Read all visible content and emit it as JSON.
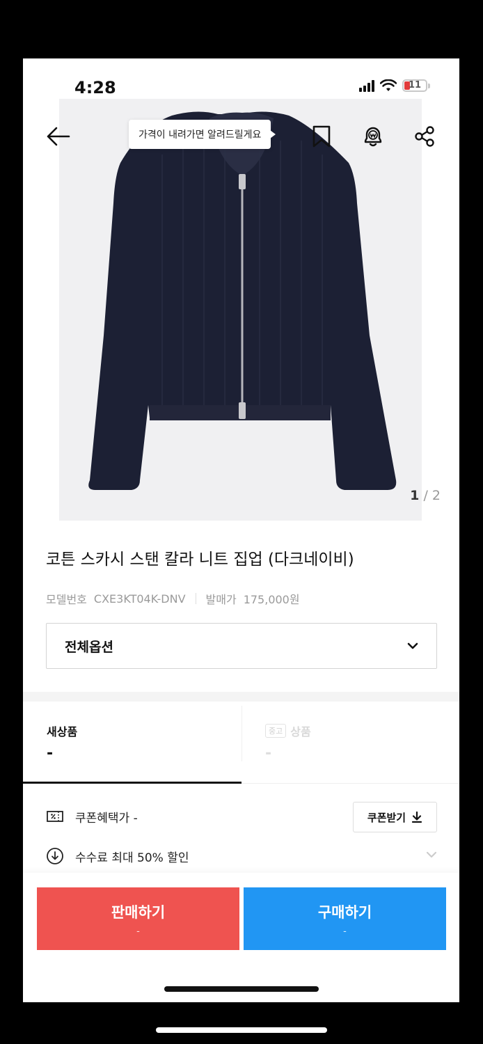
{
  "status_bar": {
    "time": "4:28",
    "battery": "11",
    "battery_color": "#e23b3b"
  },
  "nav": {
    "tooltip": "가격이 내려가면 알려드릴게요",
    "icons": [
      "back-arrow-icon",
      "bookmark-icon",
      "price-alert-bell-icon",
      "share-icon"
    ]
  },
  "gallery": {
    "current": "1",
    "total": "2",
    "separator": "/"
  },
  "product": {
    "title": "코튼 스카시 스탠 칼라 니트 집업 (다크네이비)",
    "model_label": "모델번호",
    "model_number": "CXE3KT04K-DNV",
    "release_label": "발매가",
    "release_price": "175,000원"
  },
  "option_select": {
    "label": "전체옵션"
  },
  "tabs": {
    "new": {
      "label": "새상품",
      "value": "-"
    },
    "used": {
      "badge": "중고",
      "label": "상품",
      "value": "-"
    }
  },
  "coupon": {
    "label": "쿠폰혜택가 -",
    "button": "쿠폰받기"
  },
  "fee": {
    "label": "수수료 최대 50% 할인"
  },
  "actions": {
    "sell": {
      "label": "판매하기",
      "sub": "-",
      "color": "#ef5350"
    },
    "buy": {
      "label": "구매하기",
      "sub": "-",
      "color": "#2196f3"
    }
  }
}
